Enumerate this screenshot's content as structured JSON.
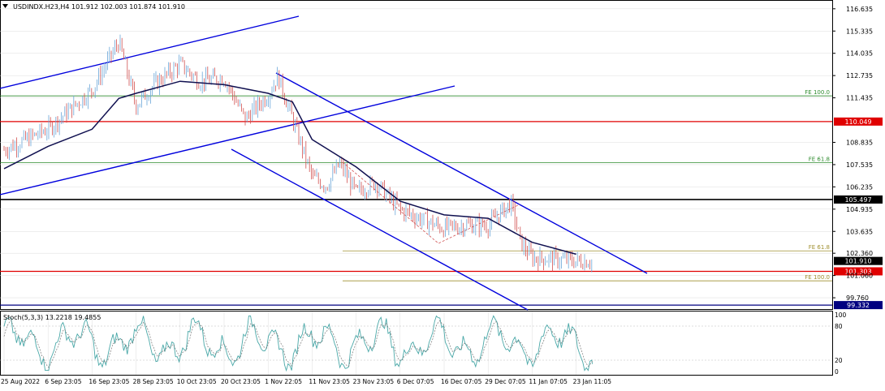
{
  "chart_data": [
    {
      "type": "candlestick",
      "title": "USDINDX.H23,H4  101.912 102.003 101.874 101.910",
      "ylim": [
        99.1,
        117.1
      ],
      "x_labels": [
        "25 Aug 2022",
        "6 Sep 23:05",
        "16 Sep 23:05",
        "28 Sep 23:05",
        "10 Oct 23:05",
        "20 Oct 23:05",
        "1 Nov 22:05",
        "11 Nov 23:05",
        "23 Nov 23:05",
        "6 Dec 07:05",
        "16 Dec 07:05",
        "29 Dec 07:05",
        "11 Jan 07:05",
        "23 Jan 11:05"
      ],
      "y_ticks": [
        "116.635",
        "115.335",
        "114.035",
        "112.735",
        "111.435",
        "108.835",
        "107.535",
        "106.235",
        "104.935",
        "103.635",
        "102.360",
        "101.060",
        "99.760"
      ],
      "price_path": [
        {
          "x": "25 Aug 2022",
          "y": 108.4
        },
        {
          "x": "6 Sep 23:05",
          "y": 109.6
        },
        {
          "x": "16 Sep 23:05",
          "y": 111.9
        },
        {
          "x": "22 Sep",
          "y": 114.7
        },
        {
          "x": "28 Sep 23:05",
          "y": 111.0
        },
        {
          "x": "3 Oct",
          "y": 112.3
        },
        {
          "x": "10 Oct 23:05",
          "y": 113.4
        },
        {
          "x": "14 Oct",
          "y": 112.4
        },
        {
          "x": "20 Oct 23:05",
          "y": 112.6
        },
        {
          "x": "27 Oct",
          "y": 110.2
        },
        {
          "x": "1 Nov 22:05",
          "y": 111.6
        },
        {
          "x": "3 Nov",
          "y": 112.7
        },
        {
          "x": "7 Nov",
          "y": 110.2
        },
        {
          "x": "11 Nov 23:05",
          "y": 106.8
        },
        {
          "x": "15 Nov",
          "y": 106.3
        },
        {
          "x": "17 Nov",
          "y": 107.6
        },
        {
          "x": "23 Nov 23:05",
          "y": 105.9
        },
        {
          "x": "28 Nov",
          "y": 106.5
        },
        {
          "x": "6 Dec 07:05",
          "y": 104.9
        },
        {
          "x": "16 Dec 07:05",
          "y": 103.8
        },
        {
          "x": "22 Dec",
          "y": 104.0
        },
        {
          "x": "29 Dec 07:05",
          "y": 104.0
        },
        {
          "x": "3 Jan",
          "y": 105.3
        },
        {
          "x": "6 Jan",
          "y": 103.0
        },
        {
          "x": "11 Jan 07:05",
          "y": 102.1
        },
        {
          "x": "18 Jan",
          "y": 102.0
        },
        {
          "x": "23 Jan 11:05",
          "y": 101.9
        },
        {
          "x": "26 Jan",
          "y": 101.91
        }
      ],
      "moving_average": [
        {
          "x": "25 Aug 2022",
          "y": 107.3
        },
        {
          "x": "6 Sep 23:05",
          "y": 108.6
        },
        {
          "x": "16 Sep 23:05",
          "y": 109.6
        },
        {
          "x": "22 Sep",
          "y": 111.4
        },
        {
          "x": "28 Sep 23:05",
          "y": 111.7
        },
        {
          "x": "10 Oct 23:05",
          "y": 112.4
        },
        {
          "x": "20 Oct 23:05",
          "y": 112.2
        },
        {
          "x": "1 Nov 22:05",
          "y": 111.7
        },
        {
          "x": "7 Nov",
          "y": 111.2
        },
        {
          "x": "11 Nov 23:05",
          "y": 109.0
        },
        {
          "x": "23 Nov 23:05",
          "y": 107.4
        },
        {
          "x": "6 Dec 07:05",
          "y": 105.4
        },
        {
          "x": "16 Dec 07:05",
          "y": 104.6
        },
        {
          "x": "29 Dec 07:05",
          "y": 104.4
        },
        {
          "x": "11 Jan 07:05",
          "y": 103.0
        },
        {
          "x": "23 Jan 11:05",
          "y": 102.3
        }
      ],
      "price_levels": [
        {
          "value": 110.049,
          "label": "110.049",
          "role": "support/resistance",
          "color": "#e00000"
        },
        {
          "value": 105.497,
          "label": "105.497",
          "role": "key level",
          "color": "#000000"
        },
        {
          "value": 101.303,
          "label": "101.303",
          "role": "support",
          "color": "#e00000"
        },
        {
          "value": 101.91,
          "label": "101.910",
          "role": "current price",
          "color": "#000000"
        },
        {
          "value": 99.332,
          "label": "99.332",
          "role": "level",
          "color": "#000080"
        }
      ],
      "fibonacci_expansions": [
        {
          "label": "FE 100.0",
          "value": 111.55,
          "color": "#2e8b2e"
        },
        {
          "label": "FE 61.8",
          "value": 107.65,
          "color": "#2e8b2e"
        },
        {
          "label": "FE 61.8",
          "value": 102.5,
          "color": "#a09030"
        },
        {
          "label": "FE 100.0",
          "value": 100.75,
          "color": "#a09030"
        }
      ],
      "trend_channels": [
        {
          "name": "rising channel",
          "color": "#0000dd"
        },
        {
          "name": "falling channel",
          "color": "#0000dd"
        }
      ],
      "colors": {
        "bull": "#6aa6d8",
        "bear": "#d05050",
        "ma": "#101050",
        "grid": "#dddddd"
      }
    },
    {
      "type": "line",
      "title": "Stoch(5,3,3) 13.2218 19.4855",
      "ylim": [
        0,
        100
      ],
      "y_ticks": [
        "100",
        "80",
        "20",
        "0"
      ],
      "main_last": 13.2218,
      "signal_last": 19.4855,
      "levels": [
        80,
        20
      ],
      "colors": {
        "main": "#4aa8a8",
        "signal": "#777777",
        "level": "#bbbbbb"
      }
    }
  ]
}
